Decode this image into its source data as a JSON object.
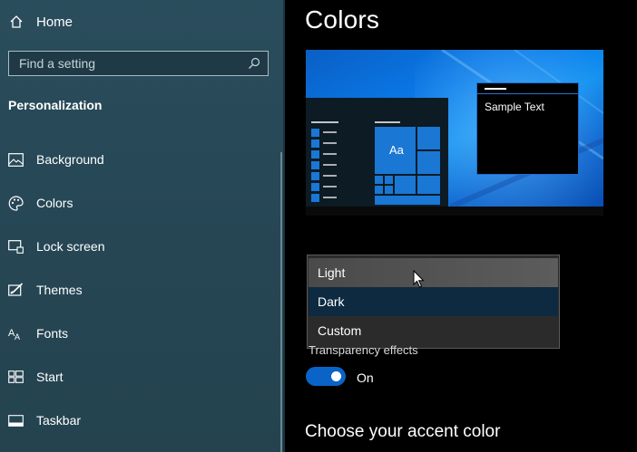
{
  "sidebar": {
    "home_label": "Home",
    "search_placeholder": "Find a setting",
    "section_title": "Personalization",
    "items": [
      {
        "label": "Background",
        "icon": "picture-icon"
      },
      {
        "label": "Colors",
        "icon": "palette-icon"
      },
      {
        "label": "Lock screen",
        "icon": "lock-screen-icon"
      },
      {
        "label": "Themes",
        "icon": "themes-icon"
      },
      {
        "label": "Fonts",
        "icon": "fonts-icon"
      },
      {
        "label": "Start",
        "icon": "start-icon"
      },
      {
        "label": "Taskbar",
        "icon": "taskbar-icon"
      }
    ]
  },
  "main": {
    "title": "Colors",
    "preview": {
      "sample_text": "Sample Text",
      "tile_label": "Aa"
    },
    "dropdown": {
      "options": [
        "Light",
        "Dark",
        "Custom"
      ],
      "hovered": "Light",
      "selected": "Dark"
    },
    "transparency_label": "Transparency effects",
    "toggle_state": "On",
    "accent_heading": "Choose your accent color"
  },
  "colors": {
    "accent": "#0a64c8",
    "sidebar_bg": "#264654",
    "main_bg": "#000000"
  }
}
